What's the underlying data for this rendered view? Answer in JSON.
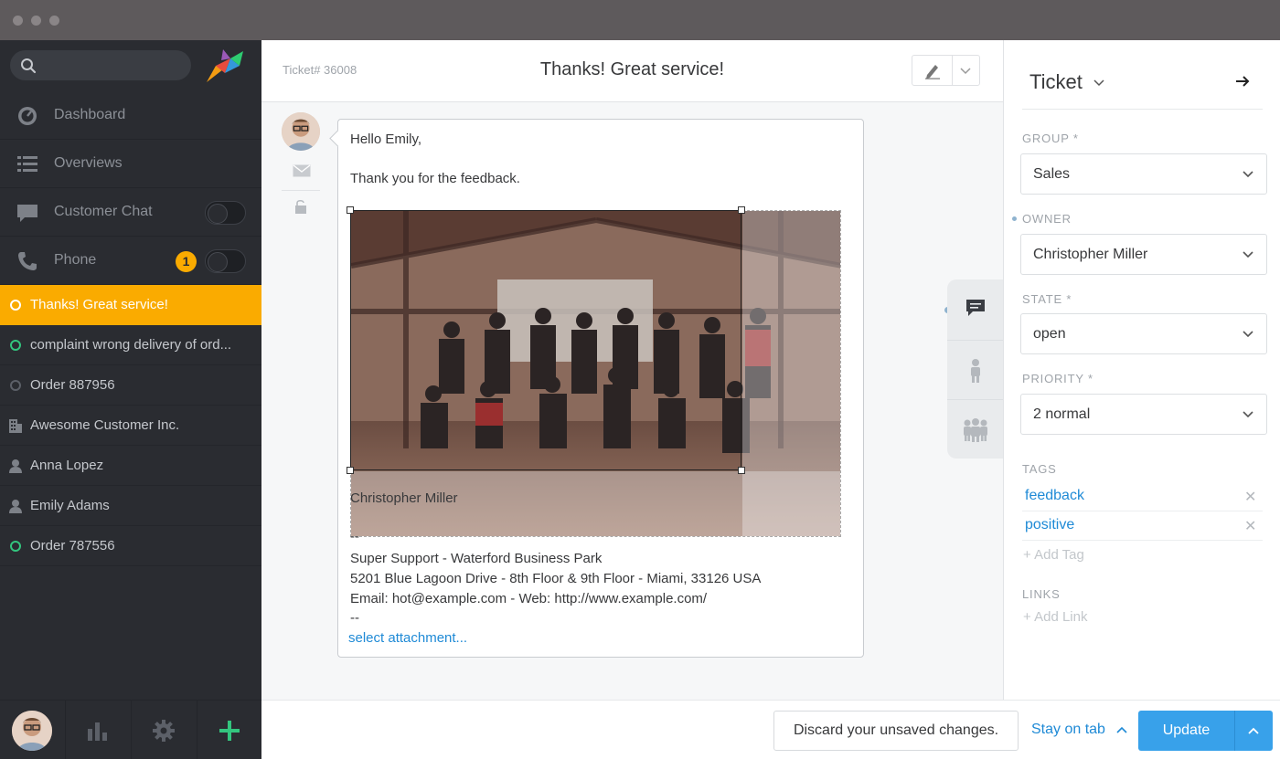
{
  "search": {
    "placeholder": ""
  },
  "nav": [
    {
      "label": "Dashboard",
      "icon": "dashboard-icon"
    },
    {
      "label": "Overviews",
      "icon": "list-icon"
    },
    {
      "label": "Customer Chat",
      "icon": "chat-icon",
      "toggle": false
    },
    {
      "label": "Phone",
      "icon": "phone-icon",
      "badge": "1",
      "toggle": false
    }
  ],
  "tasks": [
    {
      "label": "Thanks! Great service!",
      "active": true
    },
    {
      "label": "complaint wrong delivery of ord...",
      "status": "open"
    },
    {
      "label": "Order 887956",
      "status": "closed"
    },
    {
      "label": "Awesome Customer Inc.",
      "icon": "organization-icon"
    },
    {
      "label": "Anna Lopez",
      "icon": "user-icon"
    },
    {
      "label": "Emily Adams",
      "icon": "user-icon"
    },
    {
      "label": "Order 787556",
      "status": "open"
    }
  ],
  "ticket": {
    "number": "Ticket# 36008",
    "title": "Thanks! Great service!"
  },
  "article": {
    "greeting": "Hello Emily,",
    "body": "Thank you for the feedback.",
    "signature_name": "Christopher Miller",
    "dashes1": "--",
    "company": "Super Support - Waterford Business Park",
    "address": "5201 Blue Lagoon Drive - 8th Floor & 9th Floor - Miami, 33126 USA",
    "contact": "Email: hot@example.com - Web: http://www.example.com/",
    "dashes2": "--",
    "attachment_link": "select attachment..."
  },
  "bottom": {
    "discard": "Discard your unsaved changes.",
    "stay": "Stay on tab",
    "update": "Update"
  },
  "panel": {
    "title": "Ticket",
    "group_label": "GROUP *",
    "group_value": "Sales",
    "owner_label": "OWNER",
    "owner_value": "Christopher Miller",
    "state_label": "STATE *",
    "state_value": "open",
    "priority_label": "PRIORITY *",
    "priority_value": "2 normal",
    "tags_label": "TAGS",
    "tags": [
      "feedback",
      "positive"
    ],
    "add_tag": "+ Add Tag",
    "links_label": "LINKS",
    "add_link": "+ Add Link"
  },
  "colors": {
    "accent": "#faab00",
    "link": "#1f8ad6",
    "primary_button": "#38a1ea",
    "status_open": "#33c57e",
    "sidebar_bg": "#2a2c31"
  }
}
